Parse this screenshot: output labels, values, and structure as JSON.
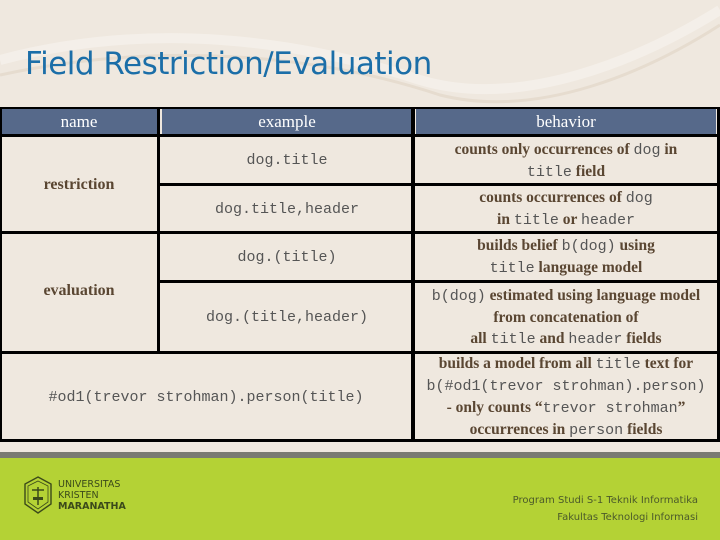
{
  "slide": {
    "title": "Field Restriction/Evaluation"
  },
  "table": {
    "headers": {
      "name": "name",
      "example": "example",
      "behavior": "behavior"
    },
    "groups": [
      {
        "name": "restriction"
      },
      {
        "name": "evaluation"
      }
    ],
    "rows": [
      {
        "example": "dog.title",
        "behavior": [
          [
            {
              "t": "counts only occurrences of "
            },
            {
              "t": "dog",
              "m": 1
            },
            {
              "t": " in"
            }
          ],
          [
            {
              "t": "title",
              "m": 1
            },
            {
              "t": " field"
            }
          ]
        ]
      },
      {
        "example": "dog.title,header",
        "behavior": [
          [
            {
              "t": "counts occurrences of "
            },
            {
              "t": "dog",
              "m": 1
            }
          ],
          [
            {
              "t": "in "
            },
            {
              "t": "title",
              "m": 1
            },
            {
              "t": " or "
            },
            {
              "t": "header",
              "m": 1
            }
          ]
        ]
      },
      {
        "example": "dog.(title)",
        "behavior": [
          [
            {
              "t": "builds belief "
            },
            {
              "t": "b(dog)",
              "m": 1
            },
            {
              "t": " using"
            }
          ],
          [
            {
              "t": "title",
              "m": 1
            },
            {
              "t": " language model"
            }
          ]
        ]
      },
      {
        "example": "dog.(title,header)",
        "behavior": [
          [
            {
              "t": "b(dog)",
              "m": 1
            },
            {
              "t": " estimated using language model"
            }
          ],
          [
            {
              "t": "from concatenation of"
            }
          ],
          [
            {
              "t": "all "
            },
            {
              "t": "title",
              "m": 1
            },
            {
              "t": " and "
            },
            {
              "t": "header",
              "m": 1
            },
            {
              "t": " fields"
            }
          ]
        ]
      },
      {
        "example": "#od1(trevor strohman).person(title)",
        "behavior": [
          [
            {
              "t": "builds a model from all "
            },
            {
              "t": "title",
              "m": 1
            },
            {
              "t": " text for"
            }
          ],
          [
            {
              "t": "b(#od1(trevor strohman).person)",
              "m": 1
            }
          ],
          [
            {
              "t": "- only counts “"
            },
            {
              "t": "trevor strohman",
              "m": 1
            },
            {
              "t": "”"
            }
          ],
          [
            {
              "t": "occurrences in "
            },
            {
              "t": "person",
              "m": 1
            },
            {
              "t": " fields"
            }
          ]
        ]
      }
    ]
  },
  "footer": {
    "logo_lines": [
      "UNIVERSITAS",
      "KRISTEN",
      "MARANATHA"
    ],
    "program_line1": "Program Studi S-1 Teknik Informatika",
    "program_line2": "Fakultas Teknologi Informasi"
  },
  "colors": {
    "title": "#1b6ea8",
    "header_bg": "#56698a",
    "footer_green": "#b4d235",
    "body_text": "#5a4632"
  }
}
